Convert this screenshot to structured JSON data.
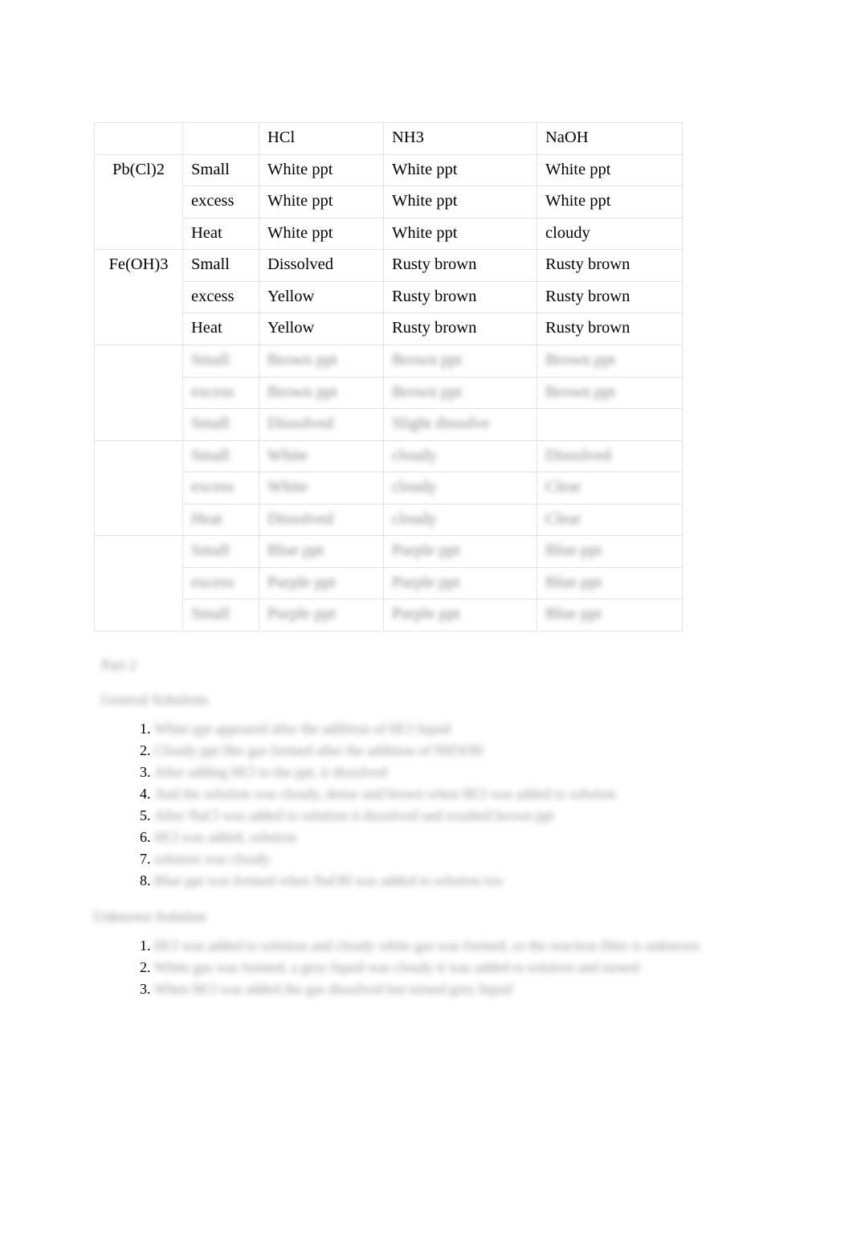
{
  "document": {
    "type": "lab-observation-report",
    "background": "#ffffff",
    "text_color": "#000000",
    "border_color": "#e3e3e3"
  },
  "table": {
    "corner_label": "",
    "column_headers": [
      "",
      "",
      "HCl",
      "NH3",
      "NaOH"
    ],
    "groups": [
      {
        "label": "Pb(Cl)2",
        "redacted": false,
        "rows": [
          {
            "condition": "Small",
            "hcl": "White ppt",
            "nh3": "White ppt",
            "naoh": "White ppt"
          },
          {
            "condition": "excess",
            "hcl": "White ppt",
            "nh3": "White ppt",
            "naoh": "White ppt"
          },
          {
            "condition": "Heat",
            "hcl": "White ppt",
            "nh3": "White ppt",
            "naoh": "cloudy"
          }
        ]
      },
      {
        "label": "Fe(OH)3",
        "redacted": false,
        "rows": [
          {
            "condition": "Small",
            "hcl": "Dissolved",
            "nh3": "Rusty brown",
            "naoh": "Rusty brown"
          },
          {
            "condition": "excess",
            "hcl": "Yellow",
            "nh3": "Rusty brown",
            "naoh": "Rusty brown"
          },
          {
            "condition": "Heat",
            "hcl": "Yellow",
            "nh3": "Rusty brown",
            "naoh": "Rusty brown"
          }
        ]
      },
      {
        "label": "",
        "redacted": true,
        "rows": [
          {
            "condition": "Small",
            "hcl": "Brown ppt",
            "nh3": "Brown ppt",
            "naoh": "Brown ppt"
          },
          {
            "condition": "excess",
            "hcl": "Brown ppt",
            "nh3": "Brown ppt",
            "naoh": "Brown ppt"
          },
          {
            "condition": "Small",
            "hcl": "Dissolved",
            "nh3": "Slight dissolve",
            "naoh": ""
          }
        ]
      },
      {
        "label": "",
        "redacted": true,
        "rows": [
          {
            "condition": "Small",
            "hcl": "White",
            "nh3": "cloudy",
            "naoh": "Dissolved"
          },
          {
            "condition": "excess",
            "hcl": "White",
            "nh3": "cloudy",
            "naoh": "Clear"
          },
          {
            "condition": "Heat",
            "hcl": "Dissolved",
            "nh3": "cloudy",
            "naoh": "Clear"
          }
        ]
      },
      {
        "label": "",
        "redacted": true,
        "rows": [
          {
            "condition": "Small",
            "hcl": "Blue ppt",
            "nh3": "Purple ppt",
            "naoh": "Blue ppt"
          },
          {
            "condition": "excess",
            "hcl": "Purple ppt",
            "nh3": "Purple ppt",
            "naoh": "Blue ppt"
          },
          {
            "condition": "Small",
            "hcl": "Purple ppt",
            "nh3": "Purple ppt",
            "naoh": "Blue ppt"
          }
        ]
      }
    ]
  },
  "notes": {
    "title": "Part 2",
    "redacted": true,
    "sections": [
      {
        "heading": "General Solutions",
        "items": [
          "White ppt appeared after the addition of HCl liquid",
          "Cloudy ppt like gas formed after the addition of NH3OH",
          "After adding HCl to the ppt, it dissolved",
          "And the solution was cloudy, dense and brown when HCl was added to solution",
          "After NaCl was added to solution it dissolved and resulted brown ppt",
          "HCl was added, solution",
          "solution was cloudy",
          "Blue ppt was formed when NaOH was added to solution too"
        ]
      },
      {
        "heading": "Unknown Solution",
        "items": [
          "HCl was added to solution and cloudy white gas was formed, so the reaction filter is unknown",
          "White gas was formed, a grey liquid was cloudy it was added to solution and turned",
          "When HCl was added the gas dissolved but turned grey liquid"
        ]
      }
    ]
  }
}
